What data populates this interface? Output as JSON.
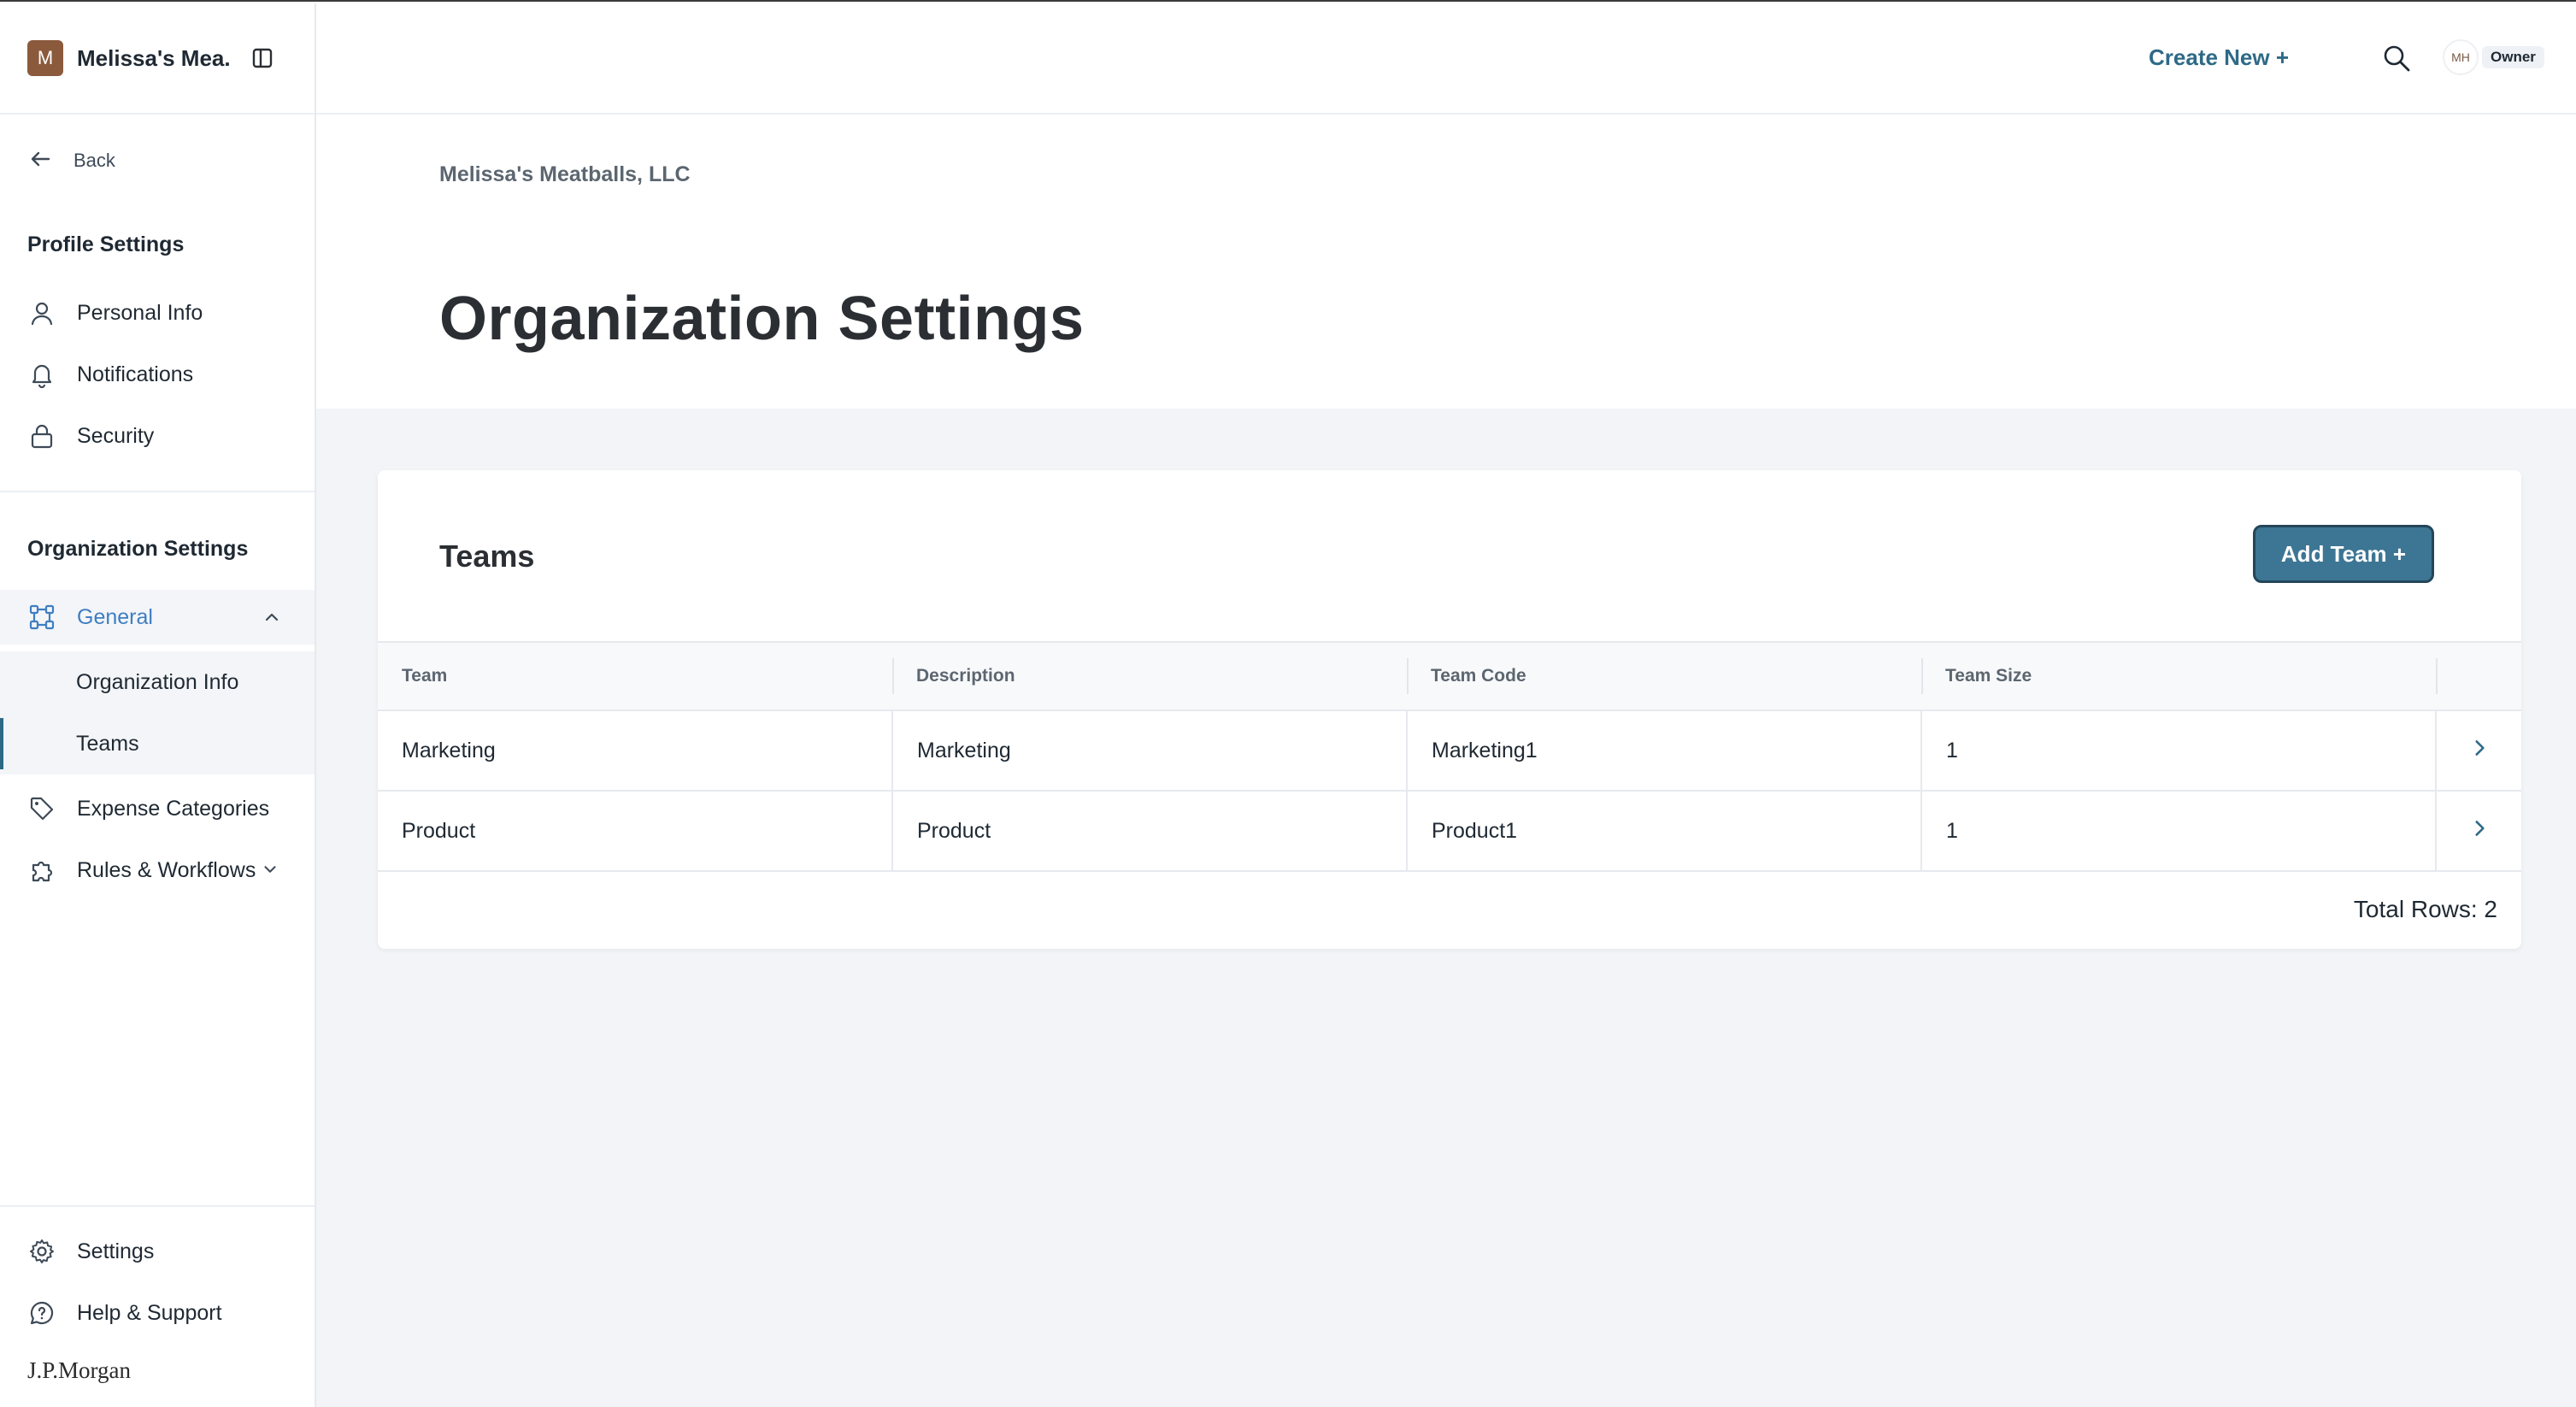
{
  "sidebar": {
    "org_initial": "M",
    "org_name": "Melissa's Mea...",
    "back_label": "Back",
    "profile_section_title": "Profile Settings",
    "profile_items": [
      {
        "label": "Personal Info",
        "icon": "user-icon"
      },
      {
        "label": "Notifications",
        "icon": "bell-icon"
      },
      {
        "label": "Security",
        "icon": "lock-icon"
      }
    ],
    "org_section_title": "Organization Settings",
    "general_label": "General",
    "general_subitems": [
      "Organization Info",
      "Teams"
    ],
    "expense_categories_label": "Expense Categories",
    "rules_workflows_label": "Rules & Workflows",
    "settings_label": "Settings",
    "help_label": "Help & Support",
    "brand": "J.P.Morgan"
  },
  "topbar": {
    "create_new_label": "Create New +",
    "user_initials": "MH",
    "role_badge": "Owner"
  },
  "main": {
    "breadcrumb": "Melissa's Meatballs, LLC",
    "title": "Organization Settings",
    "card": {
      "title": "Teams",
      "add_button_label": "Add Team +",
      "columns": [
        "Team",
        "Description",
        "Team Code",
        "Team Size"
      ],
      "rows": [
        {
          "team": "Marketing",
          "description": "Marketing",
          "code": "Marketing1",
          "size": "1"
        },
        {
          "team": "Product",
          "description": "Product",
          "code": "Product1",
          "size": "1"
        }
      ],
      "total_rows": "Total Rows: 2"
    }
  },
  "colors": {
    "accent": "#2e6a87",
    "active_nav": "#3f7ec2",
    "button_bg": "#3d7694",
    "page_bg": "#f2f4f7"
  }
}
